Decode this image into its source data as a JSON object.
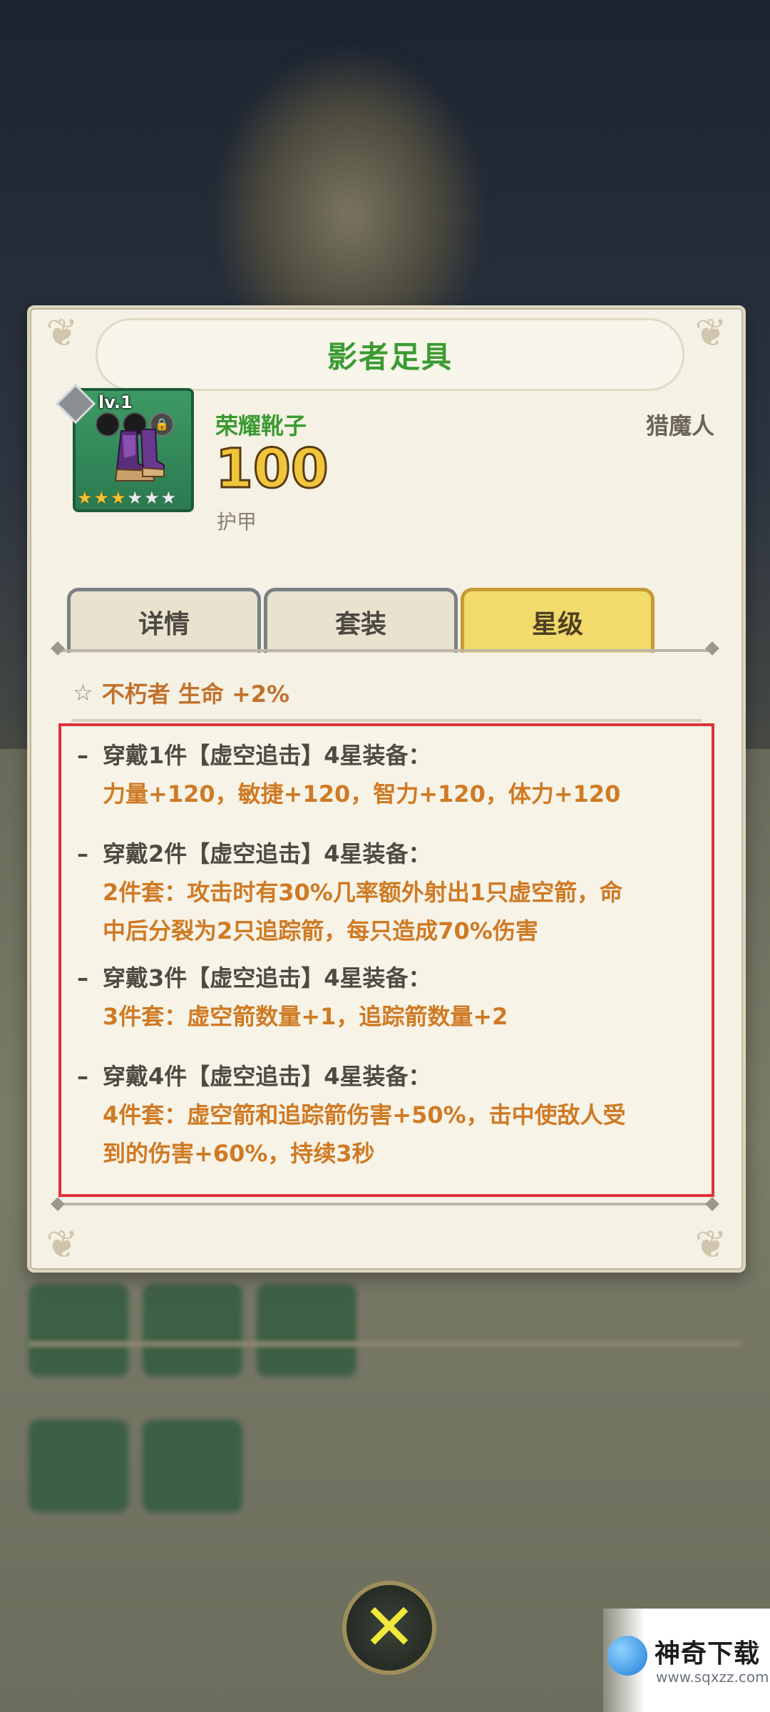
{
  "dialog": {
    "title": "影者足具",
    "item": {
      "level": "lv.1",
      "name": "荣耀靴子",
      "value": "100",
      "stat_label": "护甲",
      "class_label": "猎魔人",
      "stars_filled": 3,
      "stars_total": 6
    },
    "tabs": [
      {
        "label": "详情",
        "active": false
      },
      {
        "label": "套装",
        "active": false
      },
      {
        "label": "星级",
        "active": true
      }
    ],
    "set_bonus_line": "不朽者 生命 +2%",
    "bonuses": [
      {
        "head": "穿戴1件【虚空追击】4星装备：",
        "details": [
          "力量+120，敏捷+120，智力+120，体力+120"
        ]
      },
      {
        "head": "穿戴2件【虚空追击】4星装备：",
        "details": [
          "2件套：攻击时有30%几率额外射出1只虚空箭，命",
          "中后分裂为2只追踪箭，每只造成70%伤害"
        ]
      },
      {
        "head": "穿戴3件【虚空追击】4星装备：",
        "details": [
          "3件套：虚空箭数量+1，追踪箭数量+2"
        ]
      },
      {
        "head": "穿戴4件【虚空追击】4星装备：",
        "details": [
          "4件套：虚空箭和追踪箭伤害+50%，击中使敌人受",
          "到的伤害+60%，持续3秒"
        ]
      }
    ]
  },
  "close_button": {
    "icon": "close-x-icon"
  },
  "watermark": {
    "title": "神奇下载",
    "url": "www.sqxzz.com"
  },
  "colors": {
    "title_green": "#3b9b32",
    "bonus_orange": "#cf7a24",
    "highlight_border": "#e0313c",
    "active_tab": "#f3da6c"
  }
}
